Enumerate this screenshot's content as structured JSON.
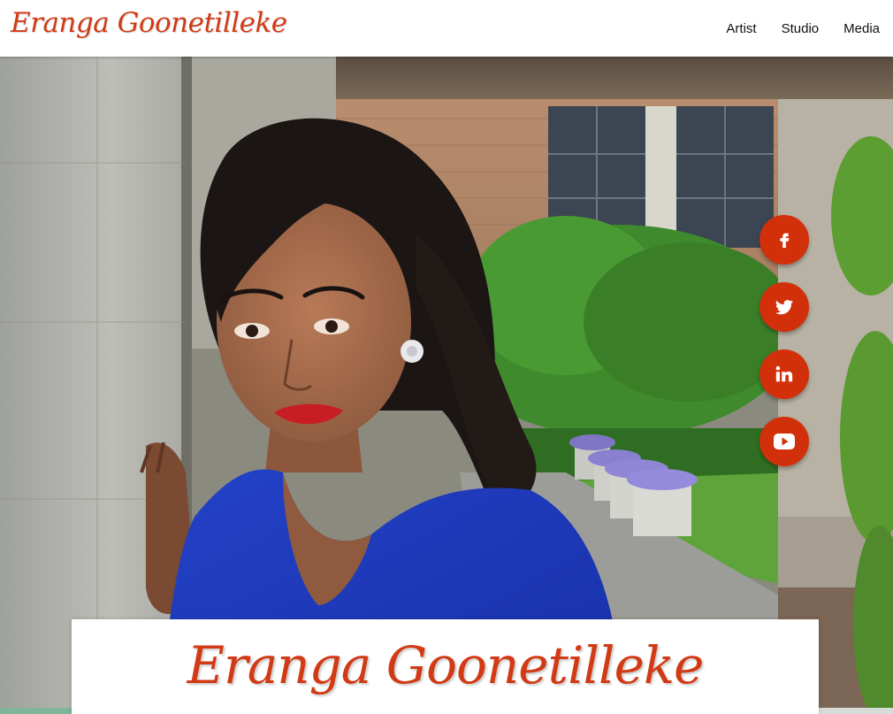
{
  "header": {
    "logo_text": "Eranga Goonetilleke",
    "nav": [
      {
        "label": "Artist"
      },
      {
        "label": "Studio"
      },
      {
        "label": "Media"
      }
    ]
  },
  "hero": {
    "image_description_icon": "portrait-photo",
    "social": [
      {
        "icon": "facebook-icon"
      },
      {
        "icon": "twitter-icon"
      },
      {
        "icon": "linkedin-icon"
      },
      {
        "icon": "youtube-icon"
      }
    ]
  },
  "card": {
    "title": "Eranga Goonetilleke"
  },
  "colors": {
    "brand": "#d13a14",
    "social_bg": "#d2300b",
    "dress": "#1f3fc4"
  }
}
